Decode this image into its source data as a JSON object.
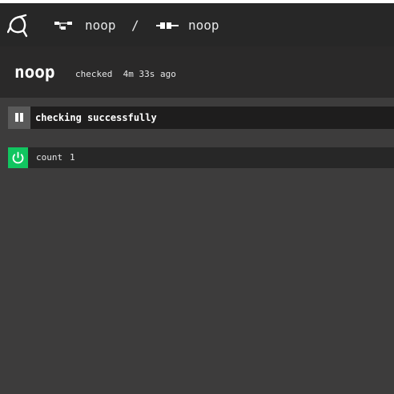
{
  "breadcrumb": {
    "pipeline_name": "noop",
    "separator": "/",
    "resource_name": "noop"
  },
  "header": {
    "title": "noop",
    "checked_label": "checked",
    "checked_ago": "4m 33s ago"
  },
  "check_status": {
    "text": "checking successfully",
    "paused": false
  },
  "versions": [
    {
      "key": "count",
      "value": "1",
      "enabled": true
    }
  ],
  "colors": {
    "enabled_green": "#11c560",
    "topbar": "#272727",
    "page_bg": "#3d3c3c"
  },
  "icons": {
    "logo": "concourse-logo-icon",
    "pipeline": "pipeline-icon",
    "resource": "resource-icon",
    "pause": "pause-icon",
    "toggle": "power-icon"
  }
}
